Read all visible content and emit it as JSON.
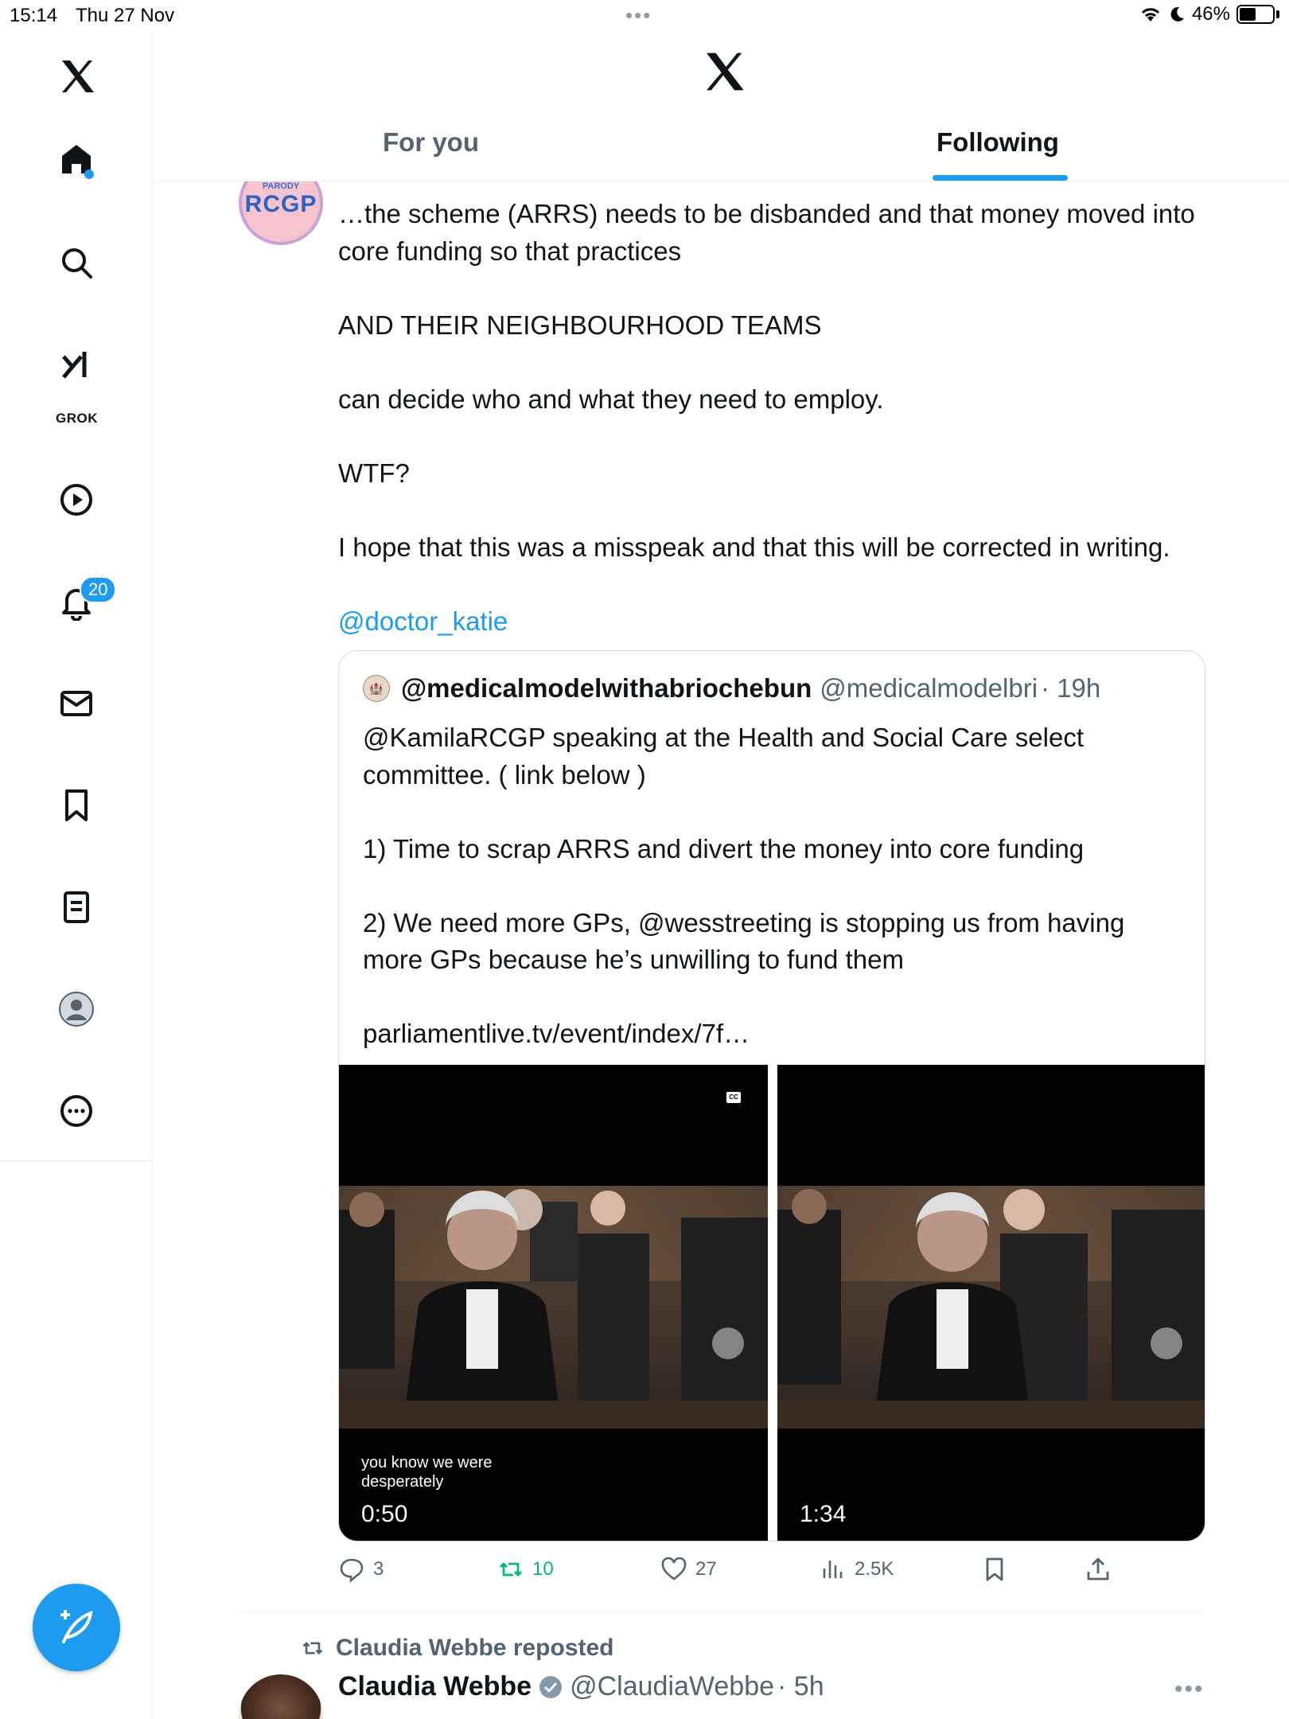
{
  "status": {
    "time": "15:14",
    "date": "Thu 27 Nov",
    "battery": "46%"
  },
  "sidebar": {
    "grok_label": "GROK",
    "notifications_badge": "20",
    "items": [
      "home-icon",
      "search-icon",
      "grok-icon",
      "video-icon",
      "bell-icon",
      "mail-icon",
      "bookmark-icon",
      "lists-icon",
      "profile-icon",
      "more-icon"
    ]
  },
  "header": {
    "tabs": [
      {
        "label": "For you",
        "active": false
      },
      {
        "label": "Following",
        "active": true
      }
    ]
  },
  "tweet": {
    "avatar": {
      "top": "PARODY",
      "main": "RCGP"
    },
    "lines": [
      "…the scheme (ARRS) needs to be disbanded and that money moved into core funding so that practices",
      "AND THEIR NEIGHBOURHOOD TEAMS",
      "can decide who and what they need to employ.",
      "WTF?",
      "I hope that this was a misspeak and that this will be corrected in writing."
    ],
    "mention": "@doctor_katie",
    "quote": {
      "name": "@medicalmodelwithabriochebun",
      "handle": "@medicalmodelbri",
      "time": "· 19h",
      "line1": "@KamilaRCGP speaking at the Health and Social Care select committee. ( link below )",
      "line2": "1) Time to scrap ARRS and divert the money into core funding",
      "line3": "2) We need more GPs, @wesstreeting is stopping us from having more GPs because he’s unwilling to fund them",
      "link": "parliamentlive.tv/event/index/7f…",
      "videos": [
        {
          "caption_line1": "you know we were",
          "caption_line2": "desperately",
          "duration": "0:50",
          "cc": "CC"
        },
        {
          "caption_line1": "",
          "caption_line2": "",
          "duration": "1:34"
        }
      ]
    },
    "actions": {
      "replies": "3",
      "reposts": "10",
      "likes": "27",
      "views": "2.5K"
    }
  },
  "next_tweet": {
    "repost_label": "Claudia Webbe reposted",
    "name": "Claudia Webbe",
    "handle": "@ClaudiaWebbe",
    "time": "· 5h"
  },
  "colors": {
    "accent": "#1d9bf0",
    "retweet": "#00ba7c",
    "muted": "#536471"
  }
}
